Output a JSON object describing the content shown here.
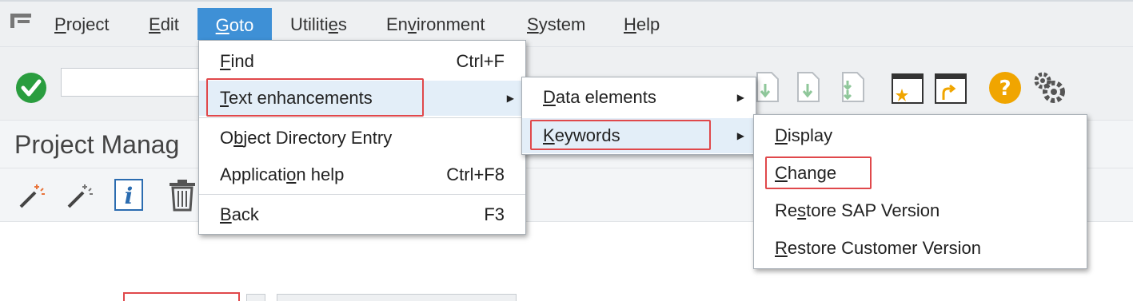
{
  "menubar": {
    "items": [
      {
        "label": "Project",
        "u": "P",
        "rest": "roject"
      },
      {
        "label": "Edit",
        "u": "E",
        "rest": "dit"
      },
      {
        "label": "Goto",
        "u": "G",
        "rest": "oto"
      },
      {
        "label": "Utilities",
        "pre": "Utiliti",
        "u": "e",
        "rest": "s"
      },
      {
        "label": "Environment",
        "pre": "En",
        "u": "v",
        "rest": "ironment"
      },
      {
        "label": "System",
        "u": "S",
        "rest": "ystem"
      },
      {
        "label": "Help",
        "u": "H",
        "rest": "elp"
      }
    ]
  },
  "title": "Project Manag",
  "goto_menu": {
    "items": [
      {
        "u": "F",
        "rest": "ind",
        "shortcut": "Ctrl+F"
      },
      {
        "u": "T",
        "rest": "ext enhancements"
      },
      {
        "pre": "O",
        "u": "b",
        "rest": "ject Directory Entry"
      },
      {
        "pre": "Applicati",
        "u": "o",
        "rest": "n help",
        "shortcut": "Ctrl+F8"
      },
      {
        "u": "B",
        "rest": "ack",
        "shortcut": "F3"
      }
    ]
  },
  "text_enh_menu": {
    "items": [
      {
        "u": "D",
        "rest": "ata elements"
      },
      {
        "u": "K",
        "rest": "eywords"
      }
    ]
  },
  "keywords_menu": {
    "items": [
      {
        "u": "D",
        "rest": "isplay"
      },
      {
        "u": "C",
        "rest": "hange"
      },
      {
        "pre": "Re",
        "u": "s",
        "rest": "tore SAP Version"
      },
      {
        "u": "R",
        "rest": "estore Customer Version"
      }
    ]
  },
  "colors": {
    "active_menu": "#3e90d6",
    "highlight": "#e3eef8",
    "red_box": "#e0484b",
    "check_green": "#2a9d3f",
    "help_orange": "#f0a500"
  }
}
